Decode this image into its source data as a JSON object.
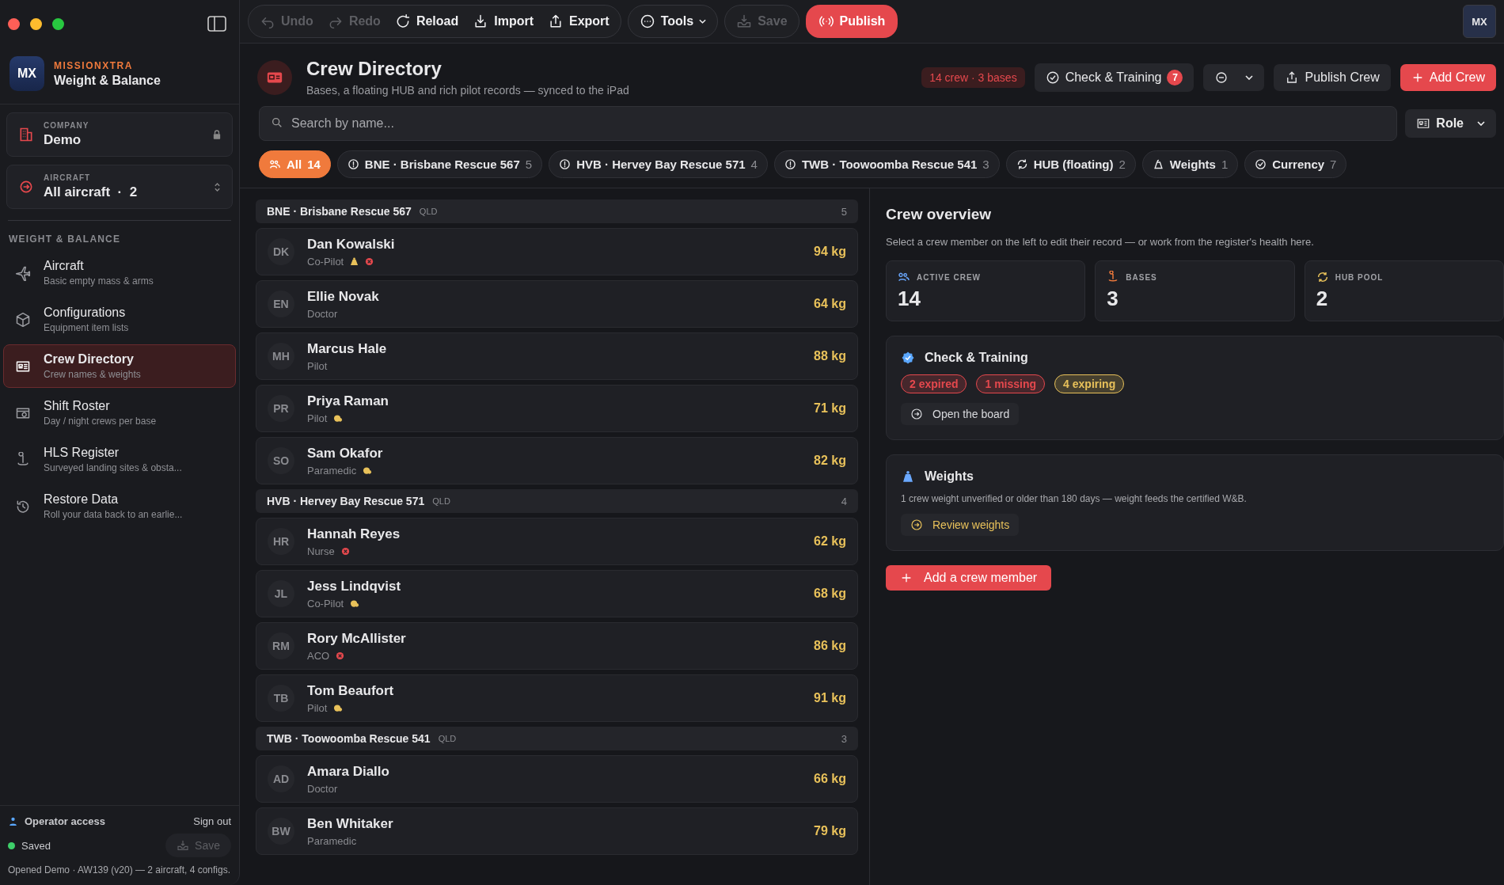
{
  "sidebar": {
    "brand": {
      "logo": "MX",
      "name": "MISSIONXTRA",
      "product": "Weight & Balance"
    },
    "company": {
      "label": "COMPANY",
      "value": "Demo",
      "locked": true
    },
    "aircraft": {
      "label": "AIRCRAFT",
      "value": "All aircraft  ·  2"
    },
    "section": "WEIGHT & BALANCE",
    "items": [
      {
        "title": "Aircraft",
        "subtitle": "Basic empty mass & arms",
        "selected": false
      },
      {
        "title": "Configurations",
        "subtitle": "Equipment item lists",
        "selected": false
      },
      {
        "title": "Crew Directory",
        "subtitle": "Crew names & weights",
        "selected": true
      },
      {
        "title": "Shift Roster",
        "subtitle": "Day / night crews per base",
        "selected": false
      },
      {
        "title": "HLS Register",
        "subtitle": "Surveyed landing sites & obsta...",
        "selected": false
      },
      {
        "title": "Restore Data",
        "subtitle": "Roll your data back to an earlie...",
        "selected": false
      }
    ],
    "footer": {
      "access": "Operator access",
      "sign_out": "Sign out",
      "status": "Saved",
      "save": {
        "label": "Save",
        "disabled": true
      },
      "note": "Opened Demo · AW139 (v20) — 2 aircraft, 4 configs."
    }
  },
  "toolbar": {
    "groups": [
      {
        "buttons": [
          {
            "label": "Undo",
            "disabled": true,
            "kind": "plain"
          },
          {
            "label": "Redo",
            "disabled": true,
            "kind": "plain"
          },
          {
            "label": "Reload",
            "disabled": false,
            "kind": "plain"
          },
          {
            "label": "Import",
            "disabled": false,
            "kind": "plain"
          },
          {
            "label": "Export",
            "disabled": false,
            "kind": "plain"
          }
        ]
      },
      {
        "buttons": [
          {
            "label": "Tools",
            "disabled": false,
            "kind": "menu"
          }
        ]
      },
      {
        "buttons": [
          {
            "label": "Save",
            "disabled": true,
            "kind": "plain"
          }
        ]
      },
      {
        "buttons": [
          {
            "label": "Publish",
            "disabled": false,
            "kind": "primary"
          }
        ]
      }
    ],
    "avatar": "MX"
  },
  "header": {
    "title": "Crew Directory",
    "subtitle": "Bases, a floating HUB and rich pilot records — synced to the iPad",
    "summary": "14 crew · 3 bases",
    "check_training": {
      "label": "Check & Training",
      "count": "7"
    },
    "publish": "Publish Crew",
    "add": "Add Crew"
  },
  "search": {
    "placeholder": "Search by name...",
    "role_filter": "Role"
  },
  "chips": [
    {
      "label": "All",
      "count": "14",
      "selected": true
    },
    {
      "label": "BNE · Brisbane Rescue 567",
      "count": "5",
      "selected": false
    },
    {
      "label": "HVB · Hervey Bay Rescue 571",
      "count": "4",
      "selected": false
    },
    {
      "label": "TWB · Toowoomba Rescue 541",
      "count": "3",
      "selected": false
    },
    {
      "label": "HUB (floating)",
      "count": "2",
      "selected": false
    },
    {
      "label": "Weights",
      "count": "1",
      "selected": false
    },
    {
      "label": "Currency",
      "count": "7",
      "selected": false
    }
  ],
  "groups": [
    {
      "name": "BNE · Brisbane Rescue 567",
      "state": "QLD",
      "count": "5",
      "crew": [
        {
          "initials": "DK",
          "name": "Dan Kowalski",
          "role": "Co-Pilot",
          "weight_unverified": true,
          "expired": true,
          "expiring": false,
          "weight": "94 kg"
        },
        {
          "initials": "EN",
          "name": "Ellie Novak",
          "role": "Doctor",
          "weight_unverified": false,
          "expired": false,
          "expiring": false,
          "weight": "64 kg"
        },
        {
          "initials": "MH",
          "name": "Marcus Hale",
          "role": "Pilot",
          "weight_unverified": false,
          "expired": false,
          "expiring": false,
          "weight": "88 kg"
        },
        {
          "initials": "PR",
          "name": "Priya Raman",
          "role": "Pilot",
          "weight_unverified": false,
          "expired": false,
          "expiring": true,
          "weight": "71 kg"
        },
        {
          "initials": "SO",
          "name": "Sam Okafor",
          "role": "Paramedic",
          "weight_unverified": false,
          "expired": false,
          "expiring": true,
          "weight": "82 kg"
        }
      ]
    },
    {
      "name": "HVB · Hervey Bay Rescue 571",
      "state": "QLD",
      "count": "4",
      "crew": [
        {
          "initials": "HR",
          "name": "Hannah Reyes",
          "role": "Nurse",
          "weight_unverified": false,
          "expired": true,
          "expiring": false,
          "weight": "62 kg"
        },
        {
          "initials": "JL",
          "name": "Jess Lindqvist",
          "role": "Co-Pilot",
          "weight_unverified": false,
          "expired": false,
          "expiring": true,
          "weight": "68 kg"
        },
        {
          "initials": "RM",
          "name": "Rory McAllister",
          "role": "ACO",
          "weight_unverified": false,
          "expired": true,
          "expiring": false,
          "weight": "86 kg"
        },
        {
          "initials": "TB",
          "name": "Tom Beaufort",
          "role": "Pilot",
          "weight_unverified": false,
          "expired": false,
          "expiring": true,
          "weight": "91 kg"
        }
      ]
    },
    {
      "name": "TWB · Toowoomba Rescue 541",
      "state": "QLD",
      "count": "3",
      "crew": [
        {
          "initials": "AD",
          "name": "Amara Diallo",
          "role": "Doctor",
          "weight_unverified": false,
          "expired": false,
          "expiring": false,
          "weight": "66 kg"
        },
        {
          "initials": "BW",
          "name": "Ben Whitaker",
          "role": "Paramedic",
          "weight_unverified": false,
          "expired": false,
          "expiring": false,
          "weight": "79 kg"
        }
      ]
    }
  ],
  "overview": {
    "title": "Crew overview",
    "intro": "Select a crew member on the left to edit their record — or work from the register's health here.",
    "stats": [
      {
        "label": "ACTIVE CREW",
        "value": "14"
      },
      {
        "label": "BASES",
        "value": "3"
      },
      {
        "label": "HUB POOL",
        "value": "2"
      }
    ],
    "check_training": {
      "title": "Check & Training",
      "pills": [
        {
          "label": "2 expired",
          "color": "#e5484d"
        },
        {
          "label": "1 missing",
          "color": "#e5484d"
        },
        {
          "label": "4 expiring",
          "color": "#e8c15a"
        }
      ],
      "action": "Open the board"
    },
    "weights": {
      "title": "Weights",
      "text": "1 crew weight unverified or older than 180 days — weight feeds the certified W&B.",
      "action": "Review weights"
    },
    "add": "Add a crew member"
  }
}
